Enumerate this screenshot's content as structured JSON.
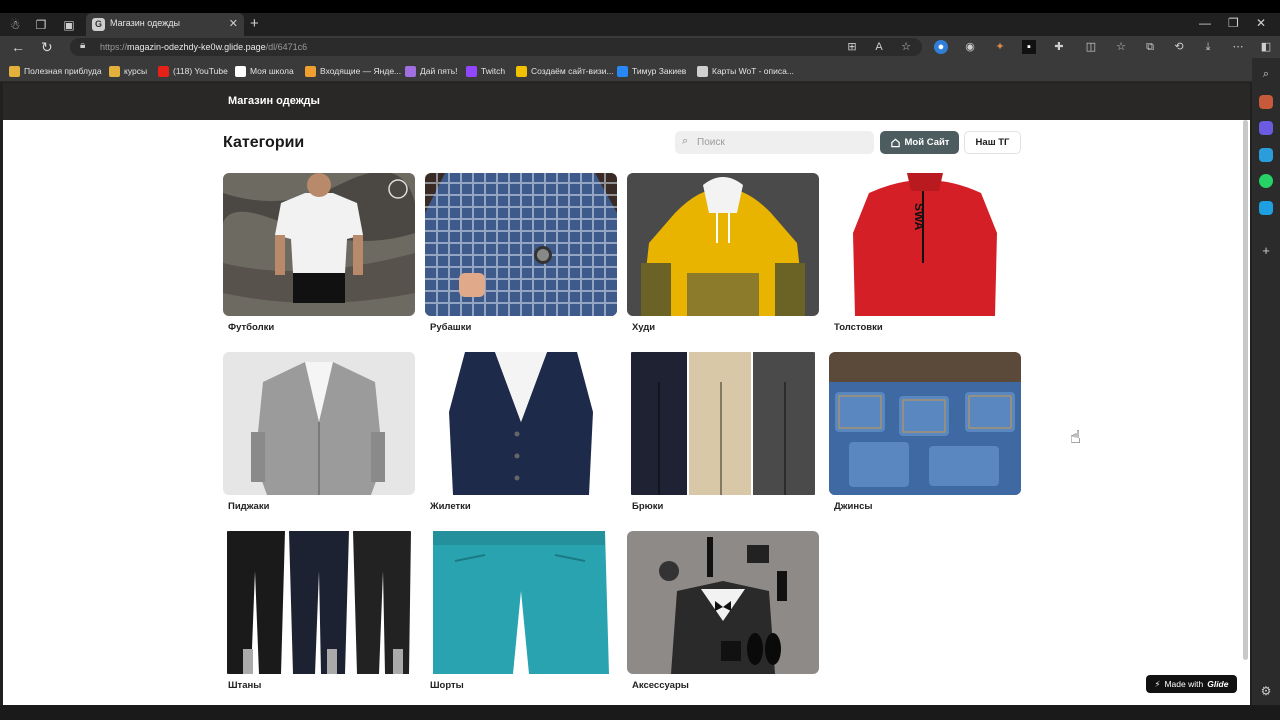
{
  "browser": {
    "tab_title": "Магазин одежды",
    "url_prefix": "https://",
    "url_host": "magazin-odezhdy-ke0w.glide.page",
    "url_path": "/dl/6471c6",
    "bookmarks": [
      {
        "label": "Полезная приблуда",
        "color": "#e2b03b"
      },
      {
        "label": "курсы",
        "color": "#e2b03b"
      },
      {
        "label": "(118) YouTube",
        "color": "#e62117"
      },
      {
        "label": "Моя школа",
        "color": "#ffffff"
      },
      {
        "label": "Входящие — Яндe...",
        "color": "#f0a030"
      },
      {
        "label": "Дай пять!",
        "color": "#a070e0"
      },
      {
        "label": "Twitch",
        "color": "#9146ff"
      },
      {
        "label": "Создаём сайт-визи...",
        "color": "#f2c200"
      },
      {
        "label": "Тимур Закиев",
        "color": "#2787f5"
      },
      {
        "label": "Карты WoT - описа...",
        "color": "#cfcfcf"
      }
    ]
  },
  "app": {
    "title": "Магазин одежды",
    "heading": "Категории",
    "search_placeholder": "Поиск",
    "btn_site": "Мой Сайт",
    "btn_tg": "Наш ТГ",
    "made_with": "Made with",
    "made_with_brand": "Glide"
  },
  "categories": [
    {
      "label": "Футболки",
      "icon": "tshirt"
    },
    {
      "label": "Рубашки",
      "icon": "shirt"
    },
    {
      "label": "Худи",
      "icon": "hoodie"
    },
    {
      "label": "Толстовки",
      "icon": "sweatshirt"
    },
    {
      "label": "Пиджаки",
      "icon": "blazer"
    },
    {
      "label": "Жилетки",
      "icon": "vest"
    },
    {
      "label": "Брюки",
      "icon": "trousers"
    },
    {
      "label": "Джинсы",
      "icon": "jeans"
    },
    {
      "label": "Штаны",
      "icon": "track-pants"
    },
    {
      "label": "Шорты",
      "icon": "shorts"
    },
    {
      "label": "Аксессуары",
      "icon": "accessories"
    }
  ]
}
